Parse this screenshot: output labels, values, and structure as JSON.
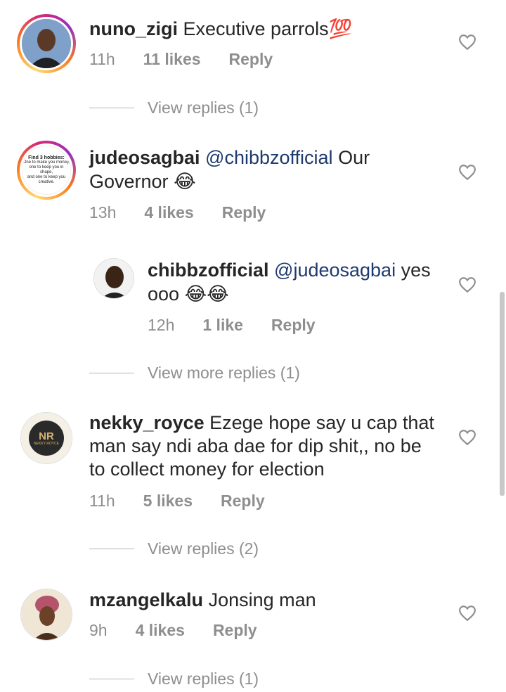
{
  "comments": [
    {
      "username": "nuno_zigi",
      "text": "Executive parrols",
      "emoji": "💯",
      "time": "11h",
      "likes": "11 likes",
      "reply": "Reply",
      "view_replies": "View replies (1)"
    },
    {
      "username": "judeosagbai",
      "mention": "@chibbzofficial",
      "text_a": "Our",
      "text_b": "Governor",
      "emoji": "😂",
      "time": "13h",
      "likes": "4 likes",
      "reply": "Reply",
      "avatar_text": {
        "title": "Find 3 hobbies:",
        "line1": "One to make you money,",
        "line2": "one to keep you in shape,",
        "line3": "and one to keep you creative."
      }
    },
    {
      "username": "chibbzofficial",
      "mention": "@judeosagbai",
      "text_a": "yes",
      "text_b": "ooo",
      "emoji": "😂😂",
      "time": "12h",
      "likes": "1 like",
      "reply": "Reply",
      "view_replies": "View more replies (1)"
    },
    {
      "username": "nekky_royce",
      "text_a": "Ezege hope say u cap that",
      "text_b": "man say ndi aba dae for dip shit,, no be",
      "text_c": "to collect money for election",
      "time": "11h",
      "likes": "5 likes",
      "reply": "Reply",
      "view_replies": "View replies (2)",
      "avatar_text": {
        "initials": "NR",
        "brand": "NEKKY ROYCE"
      }
    },
    {
      "username": "mzangelkalu",
      "text": "Jonsing man",
      "time": "9h",
      "likes": "4 likes",
      "reply": "Reply",
      "view_replies": "View replies (1)"
    }
  ],
  "icons": {
    "like": "heart-outline-icon"
  },
  "colors": {
    "mention": "#1e3a6e",
    "meta": "#8e8e8e",
    "text": "#262626"
  }
}
